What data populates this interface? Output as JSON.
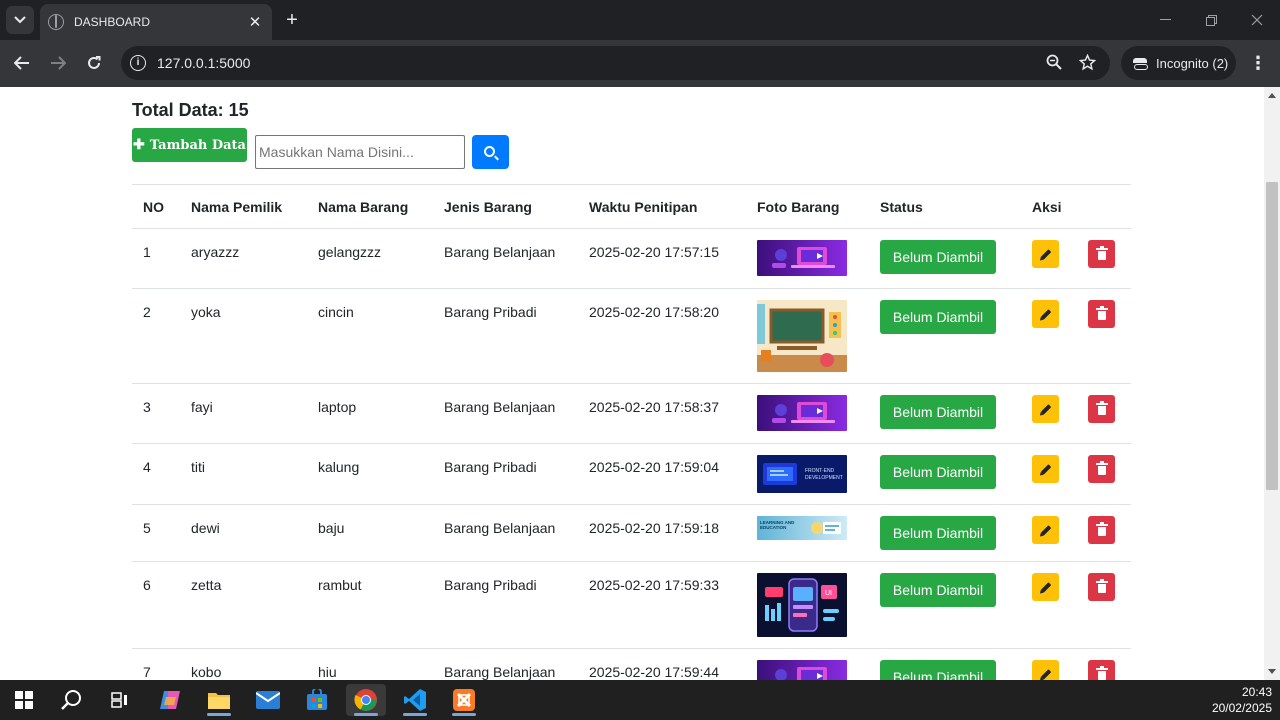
{
  "browser": {
    "tab_title": "DASHBOARD",
    "url": "127.0.0.1:5000",
    "profile_label": "Incognito (2)"
  },
  "page": {
    "total_label": "Total Data: 15",
    "add_button_label": "Tambah Data",
    "search_placeholder": "Masukkan Nama Disini...",
    "table": {
      "headers": [
        "NO",
        "Nama Pemilik",
        "Nama Barang",
        "Jenis Barang",
        "Waktu Penitipan",
        "Foto Barang",
        "Status",
        "Aksi"
      ],
      "rows": [
        {
          "no": "1",
          "owner": "aryazzz",
          "item": "gelangzzz",
          "type": "Barang Belanjaan",
          "time": "2025-02-20 17:57:15",
          "photo": "purple-laptop",
          "status": "Belum Diambil"
        },
        {
          "no": "2",
          "owner": "yoka",
          "item": "cincin",
          "type": "Barang Pribadi",
          "time": "2025-02-20 17:58:20",
          "photo": "classroom",
          "status": "Belum Diambil"
        },
        {
          "no": "3",
          "owner": "fayi",
          "item": "laptop",
          "type": "Barang Belanjaan",
          "time": "2025-02-20 17:58:37",
          "photo": "purple-laptop",
          "status": "Belum Diambil"
        },
        {
          "no": "4",
          "owner": "titi",
          "item": "kalung",
          "type": "Barang Pribadi",
          "time": "2025-02-20 17:59:04",
          "photo": "frontend-dev",
          "status": "Belum Diambil"
        },
        {
          "no": "5",
          "owner": "dewi",
          "item": "baju",
          "type": "Barang Belanjaan",
          "time": "2025-02-20 17:59:18",
          "photo": "learning-banner",
          "status": "Belum Diambil"
        },
        {
          "no": "6",
          "owner": "zetta",
          "item": "rambut",
          "type": "Barang Pribadi",
          "time": "2025-02-20 17:59:33",
          "photo": "ui-phone",
          "status": "Belum Diambil"
        },
        {
          "no": "7",
          "owner": "kobo",
          "item": "hiu",
          "type": "Barang Belanjaan",
          "time": "2025-02-20 17:59:44",
          "photo": "purple-laptop",
          "status": "Belum Diambil"
        }
      ]
    }
  },
  "taskbar": {
    "apps": [
      "start-icon",
      "search-icon",
      "task-view-icon",
      "copilot-icon",
      "file-explorer-icon",
      "mail-icon",
      "store-icon",
      "chrome-icon",
      "vscode-icon",
      "xampp-icon"
    ],
    "time": "20:43",
    "date": "20/02/2025"
  },
  "colors": {
    "success": "#28a745",
    "warning": "#ffc107",
    "danger": "#dc3545",
    "primary": "#007bff"
  }
}
